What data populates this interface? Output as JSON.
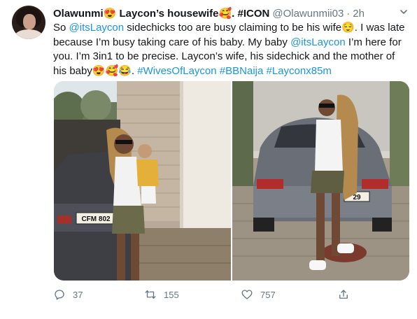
{
  "tweet": {
    "display_name": "Olawunmi😍 Laycon’s housewife🥰. #ICON",
    "handle": "@Olawunmii03",
    "separator": "·",
    "time": "2h",
    "body": {
      "p1": "So ",
      "mention1": "@itsLaycon",
      "p2": " sidechicks too are busy claiming to be his wife😌. I was late because I’m busy taking care of his baby. My baby ",
      "mention2": "@itsLaycon",
      "p3": " I’m here for you. I’m 3in1 to be precise.  Laycon’s wife, his sidechick and the mother of his baby😍🥰😂. ",
      "hashtag1": "#WivesOfLaycon",
      "hashtag2": "#BBNaija",
      "hashtag3": "#Layconx85m"
    },
    "plates": {
      "left": "CFM 802",
      "right": "29"
    }
  },
  "actions": {
    "replies": "37",
    "retweets": "155",
    "likes": "757"
  },
  "icons": {
    "menu": "chevron-down-icon",
    "reply": "reply-icon",
    "retweet": "retweet-icon",
    "like": "heart-icon",
    "share": "share-icon"
  },
  "colors": {
    "link": "#1b95e0",
    "secondary_text": "#657786"
  }
}
